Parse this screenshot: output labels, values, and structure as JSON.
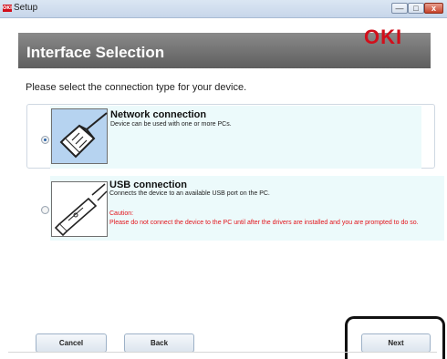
{
  "window": {
    "title": "Setup",
    "app_icon_text": "OKI",
    "controls": {
      "minimize": "—",
      "maximize": "□",
      "close": "x"
    }
  },
  "header": {
    "title": "Interface Selection",
    "logo": "OKI"
  },
  "prompt": "Please select the connection type for your device.",
  "options": [
    {
      "id": "network",
      "selected": true,
      "title": "Network connection",
      "description": "Device can be used with one or more PCs.",
      "icon": "network-cable-icon"
    },
    {
      "id": "usb",
      "selected": false,
      "title": "USB connection",
      "description": "Connects the device to an available USB port on the PC.",
      "caution_label": "Caution:",
      "caution_text": "Please do not connect the device to the PC until after the drivers are installed and you are prompted to do so.",
      "icon": "usb-cable-icon"
    }
  ],
  "buttons": {
    "cancel": "Cancel",
    "back": "Back",
    "next": "Next"
  },
  "colors": {
    "brand_red": "#d10f1b",
    "banner_gray": "#6f6f6f",
    "selected_icon_bg": "#b6d3f0",
    "option_panel_bg": "#ecfafb",
    "caution_red": "#e2141b"
  }
}
